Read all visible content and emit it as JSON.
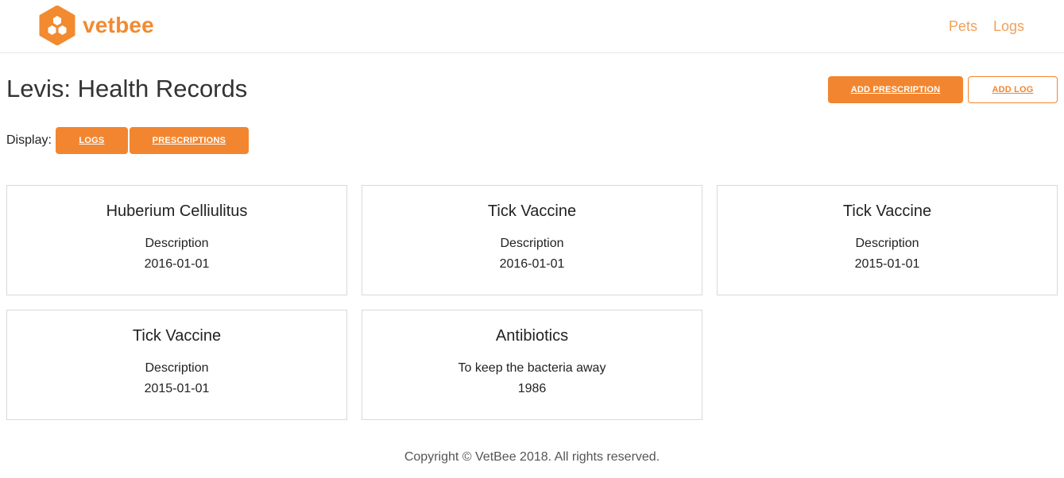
{
  "header": {
    "brand_name": "vetbee",
    "logo_icon": "honeycomb-icon",
    "nav": [
      {
        "label": "Pets"
      },
      {
        "label": "Logs"
      }
    ]
  },
  "page": {
    "title": "Levis: Health Records",
    "add_prescription_label": "ADD PRESCRIPTION",
    "add_log_label": "ADD LOG",
    "display_label": "Display:",
    "filter_logs_label": "LOGS",
    "filter_prescriptions_label": "PRESCRIPTIONS"
  },
  "records": [
    {
      "title": "Huberium Celliulitus",
      "description": "Description",
      "date": "2016-01-01"
    },
    {
      "title": "Tick Vaccine",
      "description": "Description",
      "date": "2016-01-01"
    },
    {
      "title": "Tick Vaccine",
      "description": "Description",
      "date": "2015-01-01"
    },
    {
      "title": "Tick Vaccine",
      "description": "Description",
      "date": "2015-01-01"
    },
    {
      "title": "Antibiotics",
      "description": "To keep the bacteria away",
      "date": "1986"
    }
  ],
  "footer": {
    "copyright": "Copyright © VetBee 2018. All rights reserved."
  },
  "colors": {
    "accent": "#f28630",
    "nav_link": "#f0a15a",
    "card_border": "#d9d9d9"
  }
}
